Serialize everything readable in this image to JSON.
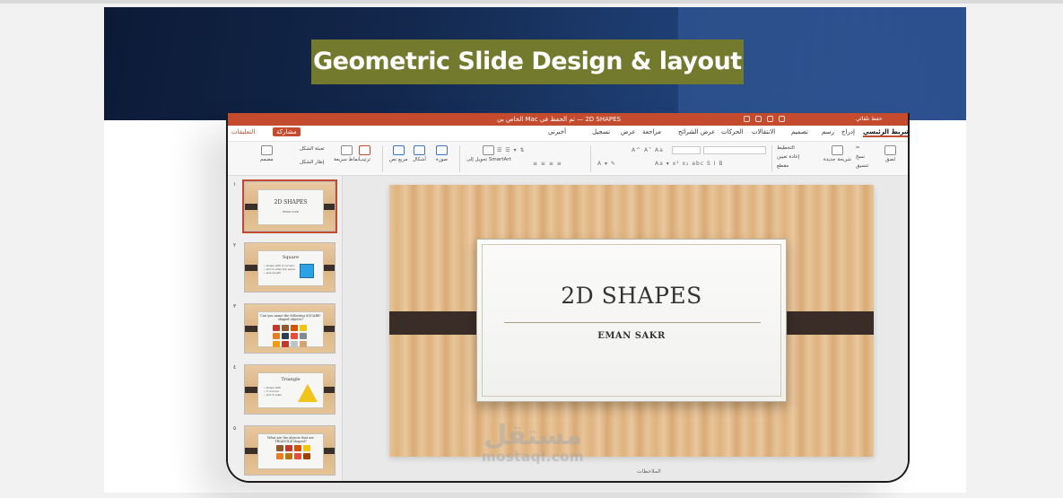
{
  "banner": {
    "title": "Geometric Slide Design & layout"
  },
  "app": {
    "window_title": "2D SHAPES — تم الحفظ في Mac الخاص بي",
    "top_right_label": "حفظ تلقائي",
    "share_label": "مشاركة",
    "comments_label": "التعليقات",
    "tabs": [
      "شريط الرئيسي",
      "إدراج",
      "رسم",
      "تصميم",
      "الانتقالات",
      "الحركات",
      "عرض الشرائح",
      "مراجعة",
      "عرض",
      "تسجيل",
      "أخبرني"
    ],
    "active_tab": "شريط الرئيسي"
  },
  "ribbon": {
    "paste": "لصق",
    "new_slide": "شريحة جديدة",
    "layout": "التخطيط",
    "reset": "إعادة تعيين",
    "section": "مقطع",
    "copy": "نسخ",
    "format": "تنسيق",
    "convert_smartart": "تحويل إلى SmartArt",
    "picture": "صورة",
    "shapes": "أشكال",
    "textbox": "مربع نص",
    "arrange": "ترتيب",
    "quick_styles": "أنماط سريعة",
    "shape_fill": "تعبئة الشكل",
    "shape_outline": "إطار الشكل",
    "designer": "مصمم",
    "font_size_row": "A^ A˅ Aa",
    "align_row": "≡ ≡ ≡ ≡"
  },
  "slides": [
    {
      "num": "١",
      "title": "2D SHAPES",
      "subtitle": "EMAN SAKR",
      "kind": "title"
    },
    {
      "num": "٢",
      "title": "Square",
      "body": "• shape with 4 corners\n• and 4 sides the same\n• size length",
      "kind": "square"
    },
    {
      "num": "٣",
      "title": "Can you name the following SQUARE-shaped objects?",
      "kind": "grid"
    },
    {
      "num": "٤",
      "title": "Triangle",
      "body": "• shape with\n• 3 corners\n• and 3 sides",
      "kind": "triangle"
    },
    {
      "num": "٥",
      "title": "What are the objects that are TRIANGLE-shaped?",
      "kind": "grid2"
    }
  ],
  "main_slide": {
    "title": "2D SHAPES",
    "subtitle": "EMAN SAKR"
  },
  "watermark": {
    "arabic": "مستقل",
    "latin": "mostaql.com"
  },
  "notes_hint": "الملاحظات",
  "colors": {
    "accent": "#c54b2e",
    "banner_title_bg": "#737a2d",
    "banner_dark": "#0c1a36"
  }
}
